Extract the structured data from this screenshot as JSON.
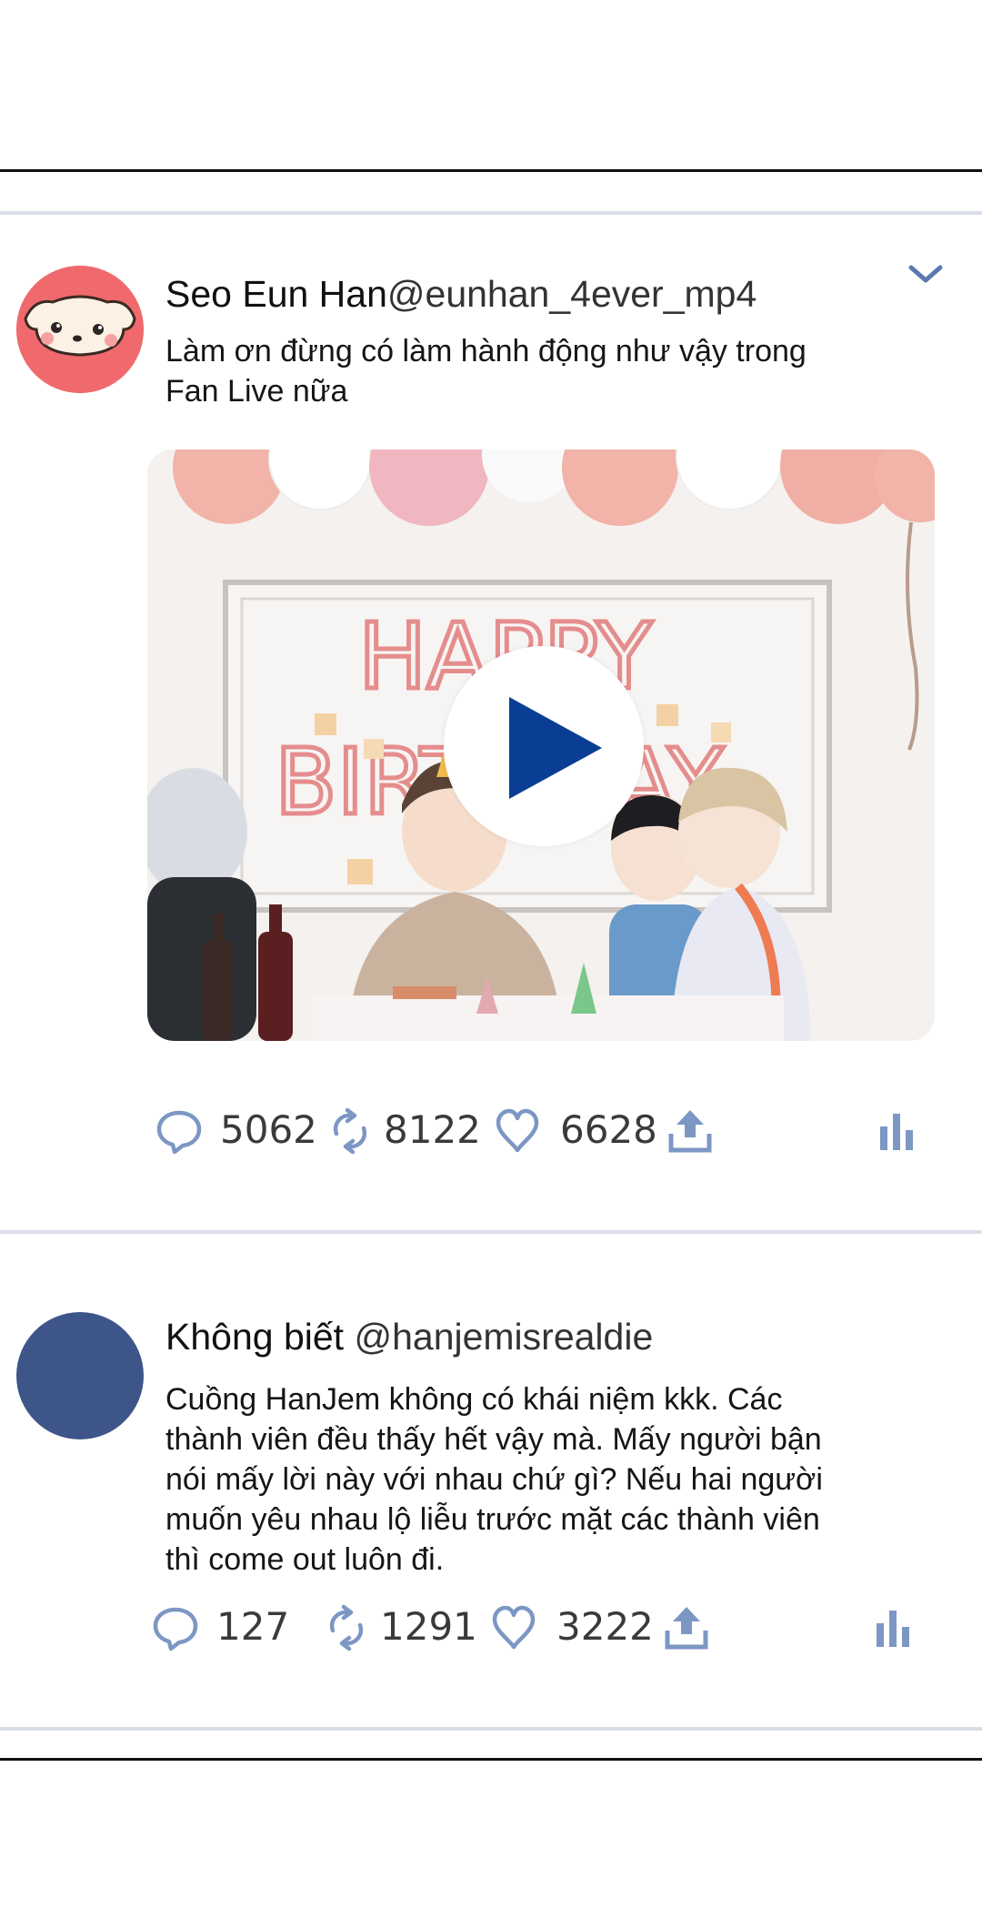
{
  "colors": {
    "accent": "#0a3e94",
    "icon": "#7c97c4",
    "separator": "#d8dde8",
    "avatar_1": "#f06a6d",
    "avatar_2": "#3d5589"
  },
  "tweets": [
    {
      "display_name": "Seo Eun Han",
      "handle": "@eunhan_4ever_mp4",
      "text_lines": [
        "Làm ơn đừng có làm hành động như vậy trong",
        "Fan Live nữa"
      ],
      "media": {
        "banner_text": "HAPPY BIRTHDAY",
        "play_icon": "play-icon"
      },
      "replies": "5062",
      "retweets": "8122",
      "likes": "6628"
    },
    {
      "display_name": "Không biết",
      "handle": "@hanjemisrealdie",
      "text_lines": [
        "Cuồng HanJem không có khái niệm kkk. Các",
        "thành viên đều thấy hết vậy mà. Mấy người bận",
        "nói mấy lời này với nhau chứ gì? Nếu hai người",
        "muốn yêu nhau lộ liễu trước mặt các thành viên",
        "thì come out luôn đi."
      ],
      "replies": "127",
      "retweets": "1291",
      "likes": "3222"
    }
  ],
  "icons": {
    "reply": "speech-bubble-icon",
    "retweet": "retweet-arrows-icon",
    "like": "heart-icon",
    "share": "share-upload-icon",
    "stats": "bar-chart-icon",
    "more": "chevron-down-icon"
  }
}
